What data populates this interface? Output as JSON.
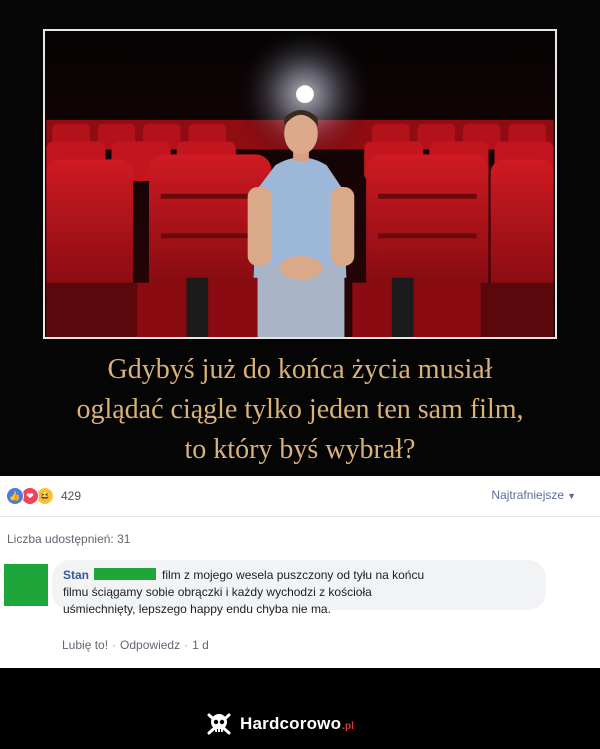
{
  "meme": {
    "caption": [
      "Gdybyś już do końca życia musiał",
      "oglądać ciągle tylko jeden ten sam film,",
      "to który byś wybrał?"
    ]
  },
  "post": {
    "reaction_count": "429",
    "reaction_icons": [
      "like-icon",
      "love-icon",
      "haha-icon"
    ],
    "sort_label": "Najtrafniejsze",
    "shares_label": "Liczba udostępnień: 31"
  },
  "comment": {
    "author": "Stan",
    "lines": [
      "film z mojego wesela puszczony od tyłu  na końcu",
      "filmu ściągamy sobie obrączki i każdy wychodzi z kościoła",
      "uśmiechnięty, lepszego happy endu chyba nie ma."
    ],
    "like_label": "Lubię to!",
    "reply_label": "Odpowiedz",
    "time": "1 d"
  },
  "footer": {
    "brand": "Hardcorowo",
    "tld": ".pl"
  },
  "colors": {
    "caption_gold": "#d9b27a",
    "seat_red": "#b3121b",
    "redaction_green": "#1fa63b",
    "fb_link": "#385898"
  }
}
